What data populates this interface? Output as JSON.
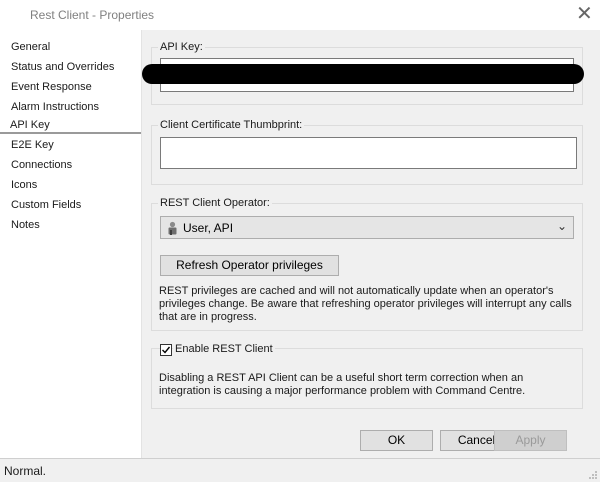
{
  "window": {
    "title": "Rest Client - Properties"
  },
  "sidebar": {
    "items": [
      {
        "label": "General"
      },
      {
        "label": "Status and Overrides"
      },
      {
        "label": "Event Response"
      },
      {
        "label": "Alarm Instructions"
      },
      {
        "label": "API Key"
      },
      {
        "label": "E2E Key"
      },
      {
        "label": "Connections"
      },
      {
        "label": "Icons"
      },
      {
        "label": "Custom Fields"
      },
      {
        "label": "Notes"
      }
    ],
    "selected": "API Key"
  },
  "api_key": {
    "label": "API Key:"
  },
  "client_cert": {
    "label": "Client Certificate Thumbprint:",
    "value": ""
  },
  "operator": {
    "label": "REST Client Operator:",
    "selected": "User, API",
    "refresh_button": "Refresh Operator privileges",
    "note": "REST privileges are cached and will not automatically update when an operator's privileges change. Be aware that refreshing operator privileges will interrupt any calls that are in progress."
  },
  "enable": {
    "checkbox_label": "Enable REST Client",
    "checked": true,
    "note": "Disabling a REST API Client can be a useful short term correction when an integration is causing a major performance problem with Command Centre."
  },
  "buttons": {
    "ok": "OK",
    "cancel": "Cancel",
    "apply": "Apply"
  },
  "status": {
    "text": "Normal."
  }
}
